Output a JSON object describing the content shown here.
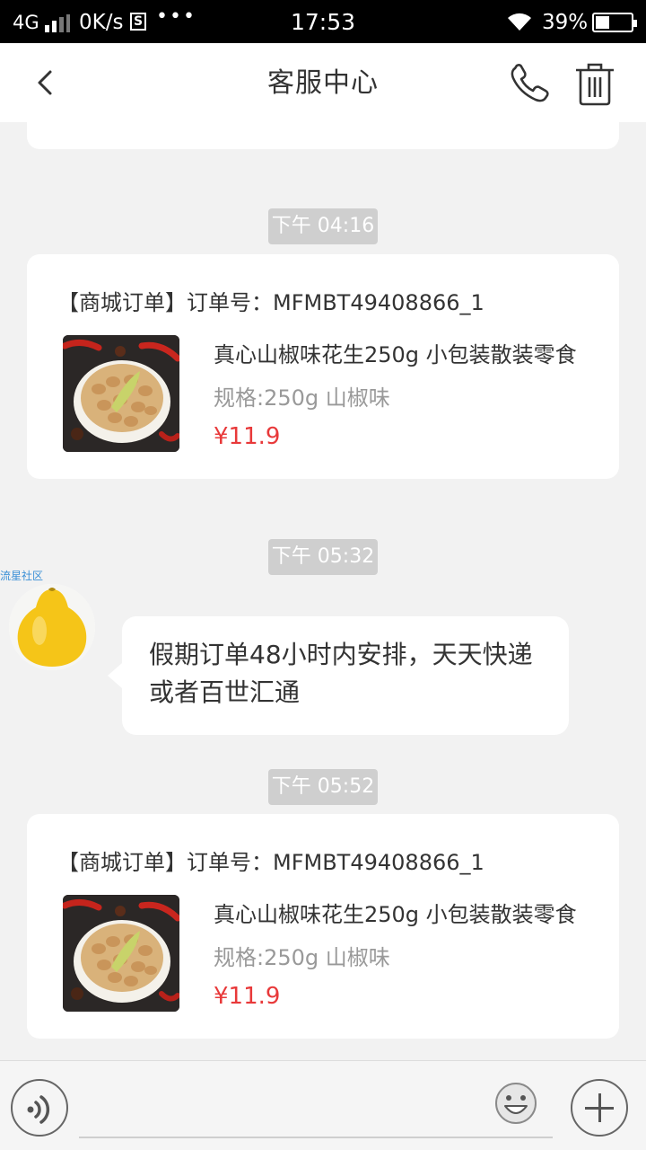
{
  "status_bar": {
    "network": "4G",
    "speed": "0K/s",
    "s_badge": "S",
    "dots": "•••",
    "time": "17:53",
    "battery_text": "39%",
    "battery_level": 0.39
  },
  "header": {
    "title": "客服中心",
    "icons": [
      "chevron-left-icon",
      "phone-icon",
      "trash-icon"
    ]
  },
  "messages": {
    "time_1": "下午 04:16",
    "order_1": {
      "title": "【商城订单】订单号：MFMBT49408866_1",
      "name": "真心山椒味花生250g 小包装散装零食",
      "spec": "规格:250g 山椒味",
      "price": "¥11.9"
    },
    "time_2": "下午 05:32",
    "sender_name": "流星社区",
    "text_message": "假期订单48小时内安排，天天快递或者百世汇通",
    "time_3": "下午 05:52",
    "order_2": {
      "title": "【商城订单】订单号：MFMBT49408866_1",
      "name": "真心山椒味花生250g 小包装散装零食",
      "spec": "规格:250g 山椒味",
      "price": "¥11.9"
    }
  },
  "input_bar": {
    "input_value": "",
    "icons": [
      "voice-icon",
      "emoji-icon",
      "plus-icon"
    ]
  }
}
